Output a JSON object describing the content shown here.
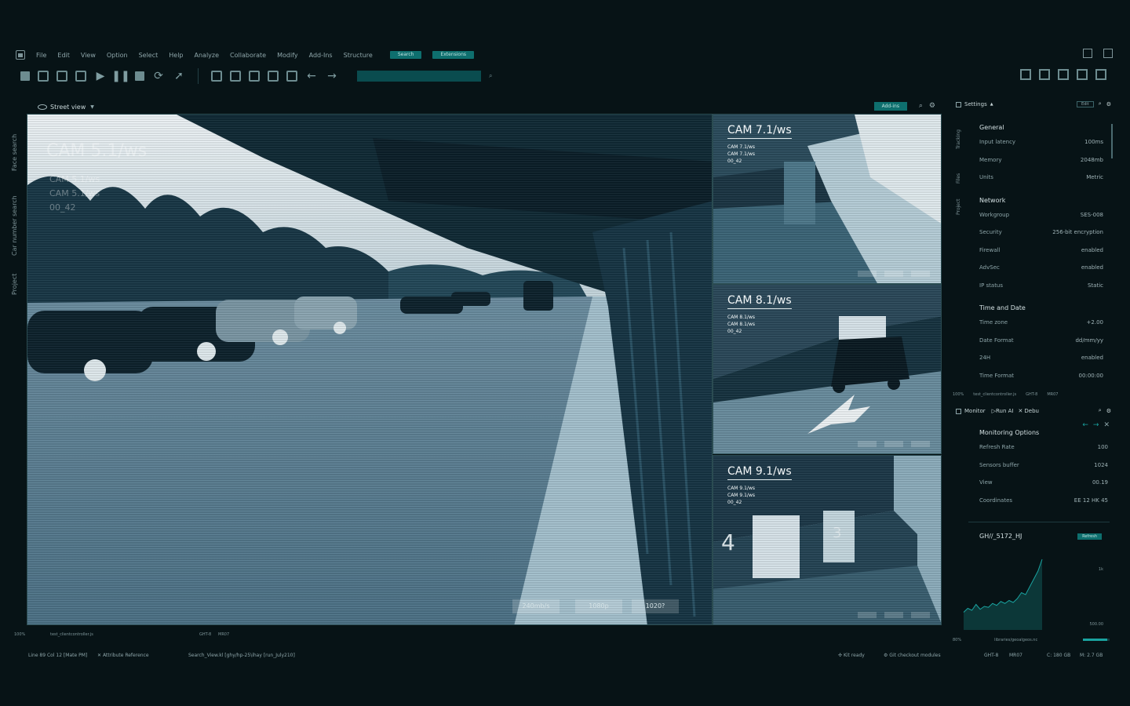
{
  "menu": {
    "items": [
      "File",
      "Edit",
      "View",
      "Option",
      "Select",
      "Help",
      "Analyze",
      "Collaborate",
      "Modify",
      "Add-Ins",
      "Structure"
    ],
    "pill_search": "Search",
    "pill_extensions": "Extensions"
  },
  "main": {
    "title": "Street view",
    "add_ins": "Add-ins",
    "left_tabs": [
      "Face search",
      "Car number search",
      "Project"
    ],
    "big_cam": {
      "title": "CAM 5.1/ws",
      "lines": [
        "CAM 5.1/ws",
        "CAM 5.1/ws",
        "00_42"
      ],
      "pills": [
        "240mb/s",
        "1080p",
        "1020?"
      ]
    },
    "cams": [
      {
        "title": "CAM 7.1/ws",
        "lines": [
          "CAM 7.1/ws",
          "CAM 7.1/ws",
          "00_42"
        ]
      },
      {
        "title": "CAM 8.1/ws",
        "lines": [
          "CAM 8.1/ws",
          "CAM 8.1/ws",
          "00_42"
        ]
      },
      {
        "title": "CAM 9.1/ws",
        "lines": [
          "CAM 9.1/ws",
          "CAM 9.1/ws",
          "00_42"
        ]
      }
    ],
    "footer": {
      "zoom": "100%",
      "file": "test_clientcontroller.js",
      "gmt": "GHT-8",
      "mr": "MR07"
    }
  },
  "status": {
    "line": "Line 89 Col 12 [Mate PM]",
    "attr": "Attribute Reference",
    "path": "Search_View.kl [ghy/hp-25\\ihay [run_July210]",
    "kit": "Kit ready",
    "git": "Git checkout modules",
    "gmt": "GHT-8",
    "mr": "MR07",
    "disk_c": "C: 180 GB",
    "disk_m": "M: 2.7 GB"
  },
  "settings": {
    "title": "Settings",
    "edit": "Edit",
    "tabs": [
      "Tracking",
      "Files",
      "Project"
    ],
    "sections": [
      {
        "title": "General",
        "rows": [
          {
            "label": "Input latency",
            "value": "100ms"
          },
          {
            "label": "Memory",
            "value": "2048mb"
          },
          {
            "label": "Units",
            "value": "Metric"
          }
        ]
      },
      {
        "title": "Network",
        "rows": [
          {
            "label": "Workgroup",
            "value": "SES-008"
          },
          {
            "label": "Security",
            "value": "256-bit encryption"
          },
          {
            "label": "Firewall",
            "value": "enabled"
          },
          {
            "label": "AdvSec",
            "value": "enabled"
          },
          {
            "label": "IP status",
            "value": "Static"
          }
        ]
      },
      {
        "title": "Time and Date",
        "rows": [
          {
            "label": "Time zone",
            "value": "+2.00"
          },
          {
            "label": "Date Format",
            "value": "dd/mm/yy"
          },
          {
            "label": "24H",
            "value": "enabled"
          },
          {
            "label": "Time Format",
            "value": "00:00:00"
          }
        ]
      }
    ],
    "footer": {
      "zoom": "100%",
      "file": "test_clientcontroller.js",
      "gmt": "GHT-8",
      "mr": "MR07"
    }
  },
  "monitor": {
    "tabs": [
      "Monitor",
      "Run AI",
      "Debu"
    ],
    "section": "Monitoring Options",
    "rows": [
      {
        "label": "Refresh Rate",
        "value": "100"
      },
      {
        "label": "Sensors buffer",
        "value": "1024"
      },
      {
        "label": "View",
        "value": "00.19"
      },
      {
        "label": "Coordinates",
        "value": "EE 12 HK 45"
      }
    ],
    "gh_title": "GH//_5172_HJ",
    "refresh": "Refresh",
    "footer_zoom": "80%",
    "footer_file": "libraries/geoalgeos.nc"
  },
  "chart_data": {
    "type": "area",
    "x": [
      0,
      1,
      2,
      3,
      4,
      5,
      6,
      7,
      8,
      9,
      10,
      11,
      12,
      13,
      14,
      15,
      16,
      17,
      18,
      19
    ],
    "values": [
      18,
      22,
      20,
      26,
      21,
      24,
      23,
      27,
      25,
      29,
      27,
      30,
      28,
      32,
      38,
      36,
      44,
      52,
      60,
      72
    ],
    "ytick_top": "1k",
    "ytick_bottom": "500.00",
    "ylim": [
      0,
      80
    ],
    "color": "#1aa3a0"
  },
  "colors": {
    "accent": "#0e6f6e",
    "background": "#071316"
  }
}
